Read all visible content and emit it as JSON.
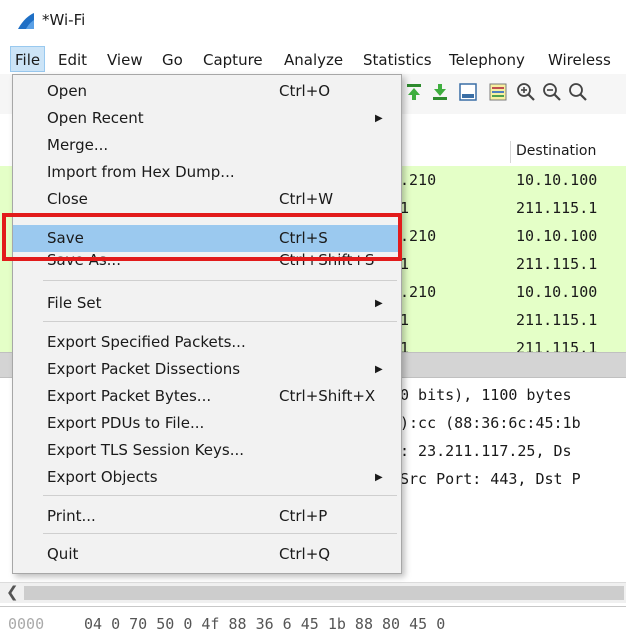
{
  "window": {
    "title": "*Wi-Fi"
  },
  "menubar": {
    "items": [
      "File",
      "Edit",
      "View",
      "Go",
      "Capture",
      "Analyze",
      "Statistics",
      "Telephony",
      "Wireless"
    ]
  },
  "packet_list": {
    "destination_header": "Destination",
    "rows": [
      {
        "src": ".210",
        "dst": "10.10.100"
      },
      {
        "src": "1",
        "dst": "211.115.1"
      },
      {
        "src": ".210",
        "dst": "10.10.100"
      },
      {
        "src": "1",
        "dst": "211.115.1"
      },
      {
        "src": ".210",
        "dst": "10.10.100"
      },
      {
        "src": "1",
        "dst": "211.115.1"
      },
      {
        "src": "1",
        "dst": "211.115.1"
      }
    ]
  },
  "details": {
    "lines": [
      "0 bits), 1100 bytes",
      "):cc (88:36:6c:45:1b",
      ": 23.211.117.25, Ds",
      "Src Port: 443, Dst P"
    ]
  },
  "bytes_pane": {
    "offset": "0000",
    "hex": "04  0 70 50 0  4f 88 36  6  45 1b  88 80 45 0"
  },
  "file_menu": {
    "items": [
      {
        "label": "Open",
        "shortcut": "Ctrl+O",
        "submenu": false
      },
      {
        "label": "Open Recent",
        "shortcut": "",
        "submenu": true
      },
      {
        "label": "Merge...",
        "shortcut": "",
        "submenu": false
      },
      {
        "label": "Import from Hex Dump...",
        "shortcut": "",
        "submenu": false
      },
      {
        "label": "Close",
        "shortcut": "Ctrl+W",
        "submenu": false
      },
      {
        "label": "Save",
        "shortcut": "Ctrl+S",
        "submenu": false,
        "highlighted": true
      },
      {
        "label": "Save As...",
        "shortcut": "Ctrl+Shift+S",
        "submenu": false
      },
      {
        "label": "File Set",
        "shortcut": "",
        "submenu": true
      },
      {
        "label": "Export Specified Packets...",
        "shortcut": "",
        "submenu": false
      },
      {
        "label": "Export Packet Dissections",
        "shortcut": "",
        "submenu": true
      },
      {
        "label": "Export Packet Bytes...",
        "shortcut": "Ctrl+Shift+X",
        "submenu": false
      },
      {
        "label": "Export PDUs to File...",
        "shortcut": "",
        "submenu": false
      },
      {
        "label": "Export TLS Session Keys...",
        "shortcut": "",
        "submenu": false
      },
      {
        "label": "Export Objects",
        "shortcut": "",
        "submenu": true
      },
      {
        "label": "Print...",
        "shortcut": "Ctrl+P",
        "submenu": false
      },
      {
        "label": "Quit",
        "shortcut": "Ctrl+Q",
        "submenu": false
      }
    ]
  },
  "colors": {
    "menu_highlight": "#9bc9ef",
    "annotation_box": "#e21b1b",
    "packet_row_green": "#e4ffc7"
  }
}
